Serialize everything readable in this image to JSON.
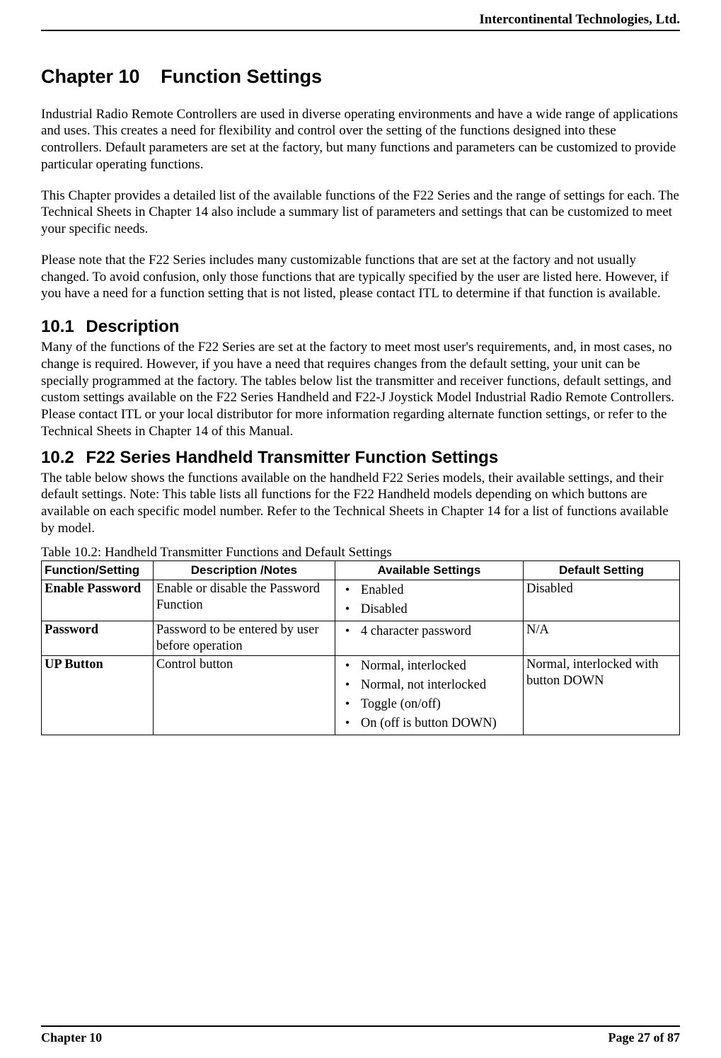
{
  "header": {
    "company": "Intercontinental Technologies, Ltd."
  },
  "chapter": {
    "number": "Chapter 10",
    "title": "Function Settings"
  },
  "paragraphs": {
    "intro1": "Industrial Radio Remote Controllers are used in diverse operating environments and have a wide range of applications and uses. This creates a need for flexibility and control over the setting of the functions designed into these controllers. Default parameters are set at the factory, but many functions and parameters can be customized to provide particular operating functions.",
    "intro2": "This Chapter provides a detailed list of the available functions of the F22 Series and the range of settings for each.  The Technical Sheets in Chapter 14 also include a summary list of parameters and settings that can be customized to meet your specific needs.",
    "intro3": "Please note that the F22 Series includes many customizable functions that are set at the factory and not usually changed.  To avoid confusion, only those functions that are typically specified by the user are listed here.  However, if you have a need for a function setting that is not listed, please contact ITL to determine if that function is available."
  },
  "section1": {
    "number": "10.1",
    "title": "Description",
    "body": "Many of the functions of the F22 Series are set at the factory to meet most user's requirements, and, in most cases, no change is required.  However, if you have a need that requires changes from the default setting, your unit can be specially programmed at the factory.  The tables below list the transmitter and receiver functions, default settings, and custom settings available on the F22 Series Handheld and F22-J Joystick Model Industrial Radio Remote Controllers.  Please contact ITL or your local distributor for more information regarding alternate function settings, or refer to the Technical Sheets in Chapter 14 of this Manual."
  },
  "section2": {
    "number": "10.2",
    "title": "F22 Series Handheld Transmitter Function Settings",
    "body": "The table below shows the functions available on the handheld F22 Series models, their available settings, and their default settings.  Note:  This table lists all functions for the F22 Handheld models depending on which buttons are available on each specific model number.  Refer to the Technical Sheets in Chapter 14 for a list of functions available by model."
  },
  "table": {
    "caption": "Table 10.2:  Handheld Transmitter Functions and Default Settings",
    "headers": {
      "fn": "Function/Setting",
      "desc": "Description /Notes",
      "avail": "Available Settings",
      "def": "Default Setting"
    },
    "rows": [
      {
        "fn": "Enable Password",
        "desc": "Enable or disable the Password Function",
        "avail": [
          "Enabled",
          "Disabled"
        ],
        "def": "Disabled"
      },
      {
        "fn": "Password",
        "desc": "Password to be entered by user before operation",
        "avail": [
          "4 character password"
        ],
        "def": "N/A"
      },
      {
        "fn": "UP Button",
        "desc": "Control button",
        "avail": [
          "Normal, interlocked",
          "Normal, not interlocked",
          "Toggle (on/off)",
          "On (off is button DOWN)"
        ],
        "def": "Normal, interlocked with button DOWN"
      }
    ]
  },
  "footer": {
    "left": "Chapter 10",
    "right": "Page 27 of 87"
  }
}
